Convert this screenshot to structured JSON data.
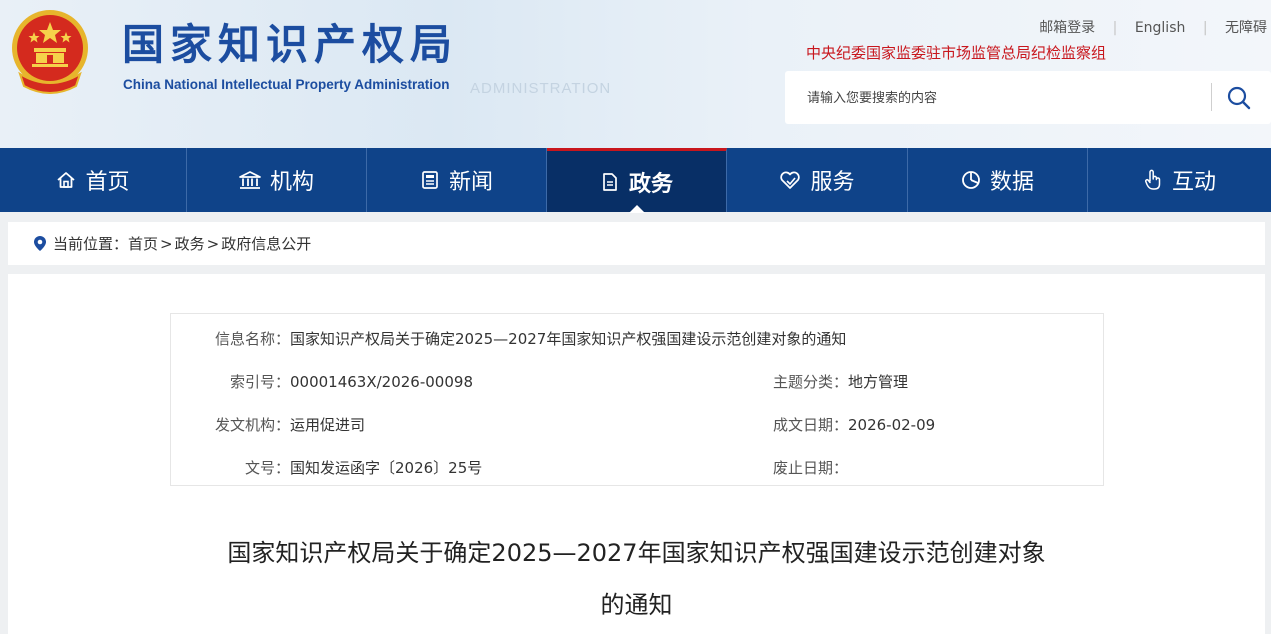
{
  "header": {
    "title": "国家知识产权局",
    "subtitle": "China National Intellectual Property Administration",
    "watermark": "ADMINISTRATION",
    "top_links": [
      "邮箱登录",
      "English",
      "无障碍"
    ],
    "discipline": "中央纪委国家监委驻市场监管总局纪检监察组",
    "search_placeholder": "请输入您要搜索的内容",
    "colors": {
      "brand_blue": "#1c4da0",
      "red": "#c8161d"
    }
  },
  "nav": {
    "items": [
      {
        "label": "首页",
        "icon": "home-icon"
      },
      {
        "label": "机构",
        "icon": "institution-icon"
      },
      {
        "label": "新闻",
        "icon": "newspaper-icon"
      },
      {
        "label": "政务",
        "icon": "document-icon",
        "active": true
      },
      {
        "label": "服务",
        "icon": "heart-hand-icon"
      },
      {
        "label": "数据",
        "icon": "pie-chart-icon"
      },
      {
        "label": "互动",
        "icon": "hand-pointer-icon"
      }
    ],
    "colors": {
      "bg": "#0f4389",
      "active_bg": "#082f66"
    }
  },
  "breadcrumb": {
    "label": "当前位置：",
    "items": [
      "首页",
      "政务",
      "政府信息公开"
    ],
    "sep": ">"
  },
  "info": {
    "name_label": "信息名称：",
    "name_value": "国家知识产权局关于确定2025—2027年国家知识产权强国建设示范创建对象的通知",
    "index_label": "索引号：",
    "index_value": "00001463X/2026-00098",
    "topic_label": "主题分类：",
    "topic_value": "地方管理",
    "org_label": "发文机构：",
    "org_value": "运用促进司",
    "date_label": "成文日期：",
    "date_value": "2026-02-09",
    "doc_no_label": "文号：",
    "doc_no_value": "国知发运函字〔2026〕25号",
    "expire_label": "废止日期：",
    "expire_value": ""
  },
  "article": {
    "title_line1": "国家知识产权局关于确定2025—2027年国家知识产权强国建设示范创建对象",
    "title_line2": "的通知"
  }
}
